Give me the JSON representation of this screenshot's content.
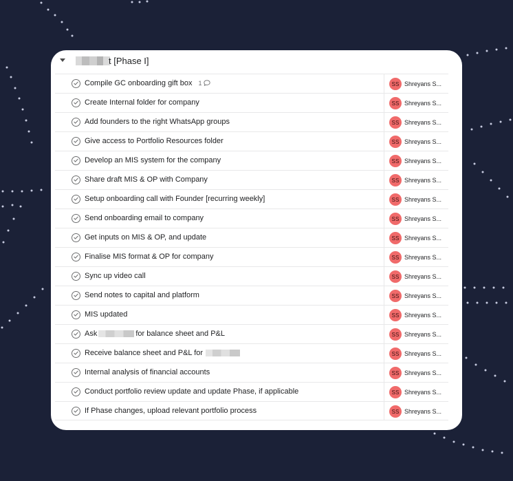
{
  "section": {
    "title": "t [Phase I]"
  },
  "assignee": {
    "initials": "SS",
    "name": "Shreyans S...",
    "avatar_color": "#f06a6a"
  },
  "tasks": [
    {
      "name": "Compile GC onboarding gift box",
      "comments": "1"
    },
    {
      "name": "Create Internal folder for company"
    },
    {
      "name": "Add founders to the right WhatsApp groups"
    },
    {
      "name": "Give access to Portfolio Resources folder"
    },
    {
      "name": "Develop an MIS system for the company"
    },
    {
      "name": "Share draft MIS & OP with Company"
    },
    {
      "name": "Setup onboarding call with Founder [recurring weekly]"
    },
    {
      "name": "Send onboarding email to company"
    },
    {
      "name": "Get inputs on MIS & OP, and update"
    },
    {
      "name": "Finalise MIS format & OP for company"
    },
    {
      "name": "Sync up video call"
    },
    {
      "name": "Send notes to capital and platform"
    },
    {
      "name": "MIS updated"
    },
    {
      "name_before": "Ask",
      "name_after": "for balance sheet and P&L"
    },
    {
      "name_before": "Receive balance sheet and P&L for"
    },
    {
      "name": "Internal analysis of financial accounts"
    },
    {
      "name": "Conduct portfolio review update and update Phase, if applicable"
    },
    {
      "name": "If Phase changes, upload relevant portfolio process"
    }
  ]
}
